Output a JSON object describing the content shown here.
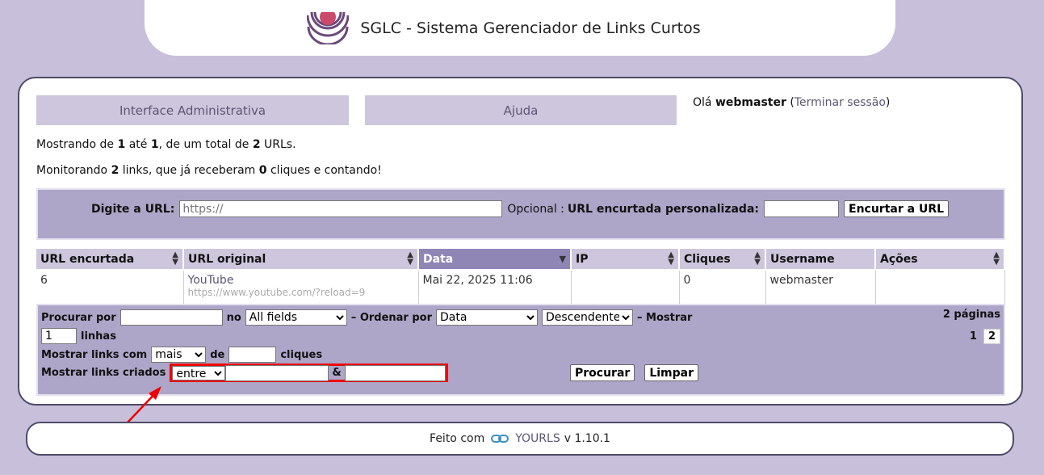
{
  "header": {
    "title": "SGLC - Sistema Gerenciador de Links Curtos"
  },
  "nav": {
    "admin": "Interface Administrativa",
    "help": "Ajuda"
  },
  "user": {
    "greeting": "Olá",
    "name": "webmaster",
    "logout": "Terminar sessão"
  },
  "stats": {
    "line1": {
      "a": "Mostrando de ",
      "from": "1",
      "b": " até ",
      "to": "1",
      "c": ", de um total de ",
      "total": "2",
      "d": " URLs."
    },
    "line2": {
      "a": "Monitorando ",
      "links": "2",
      "b": " links, que já receberam ",
      "clicks": "0",
      "c": " cliques e contando!"
    }
  },
  "add_form": {
    "url_label": "Digite a URL",
    "url_placeholder": "https://",
    "optional": "Opcional",
    "keyword_label": "URL encurtada personalizada",
    "submit": "Encurtar a URL"
  },
  "table": {
    "columns": [
      "URL encurtada",
      "URL original",
      "Data",
      "IP",
      "Cliques",
      "Username",
      "Ações"
    ],
    "rows": [
      {
        "short": "6",
        "title": "YouTube",
        "url": "https://www.youtube.com/?reload=9",
        "date": "Mai 22, 2025 11:06",
        "ip": "",
        "clicks": "0",
        "username": "webmaster",
        "actions": ""
      }
    ]
  },
  "filter": {
    "search_label": "Procurar por",
    "in_label": "no",
    "in_value": "All fields",
    "order_label": "– Ordenar por",
    "order_value": "Data",
    "direction_value": "Descendente",
    "show_label": "– Mostrar",
    "rows_value": "1",
    "rows_label": "linhas",
    "clicks_label": "Mostrar links com",
    "clicks_op": "mais",
    "de": "de",
    "clicks_unit": "cliques",
    "created_label": "Mostrar links criados",
    "created_op": "entre",
    "amp": "&",
    "search_btn": "Procurar",
    "clear_btn": "Limpar",
    "pages_label": "2 páginas",
    "pages": [
      "1",
      "2"
    ],
    "current_page": "2"
  },
  "footer": {
    "made_with": "Feito com",
    "brand": "YOURLS",
    "version": "v 1.10.1"
  },
  "colors": {
    "background": "#c8c0da",
    "accent": "#8f86b5",
    "highlight": "#e00000"
  }
}
